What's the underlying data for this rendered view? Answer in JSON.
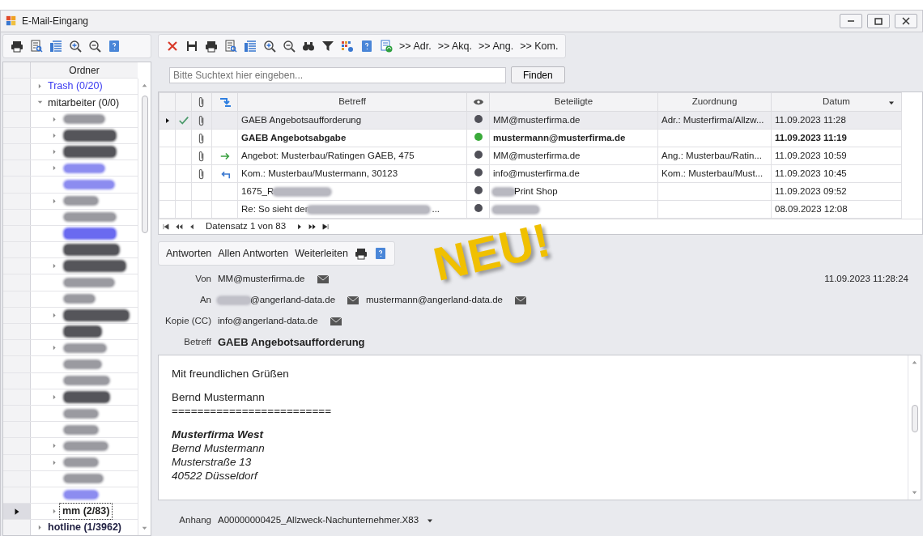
{
  "window": {
    "title": "E-Mail-Eingang"
  },
  "folder_panel": {
    "header": "Ordner",
    "folders": [
      {
        "label": "Trash (0/20)",
        "color": "#3a3af0",
        "bold": false,
        "expanded": false,
        "selected": false
      },
      {
        "label": "mitarbeiter (0/0)",
        "color": "#222222",
        "bold": false,
        "expanded": true,
        "selected": false,
        "children": [
          {
            "redacted": true,
            "expandable": true,
            "bold": false,
            "color": "#9a9aa0",
            "selected": false
          },
          {
            "redacted": true,
            "expandable": true,
            "bold": true,
            "color": "#55555a",
            "selected": false
          },
          {
            "redacted": true,
            "expandable": true,
            "bold": true,
            "color": "#55555a",
            "selected": false
          },
          {
            "redacted": true,
            "expandable": true,
            "bold": false,
            "color": "#8c8cf0",
            "selected": false
          },
          {
            "redacted": true,
            "expandable": false,
            "bold": false,
            "color": "#8c8cf0",
            "selected": false
          },
          {
            "redacted": true,
            "expandable": true,
            "bold": false,
            "color": "#9a9aa0",
            "selected": false
          },
          {
            "redacted": true,
            "expandable": false,
            "bold": false,
            "color": "#9a9aa0",
            "selected": false
          },
          {
            "redacted": true,
            "expandable": false,
            "bold": true,
            "color": "#6a6af0",
            "selected": false
          },
          {
            "redacted": true,
            "expandable": false,
            "bold": true,
            "color": "#55555a",
            "selected": false
          },
          {
            "redacted": true,
            "expandable": true,
            "bold": true,
            "color": "#55555a",
            "selected": false
          },
          {
            "redacted": true,
            "expandable": false,
            "bold": false,
            "color": "#9a9aa0",
            "selected": false
          },
          {
            "redacted": true,
            "expandable": false,
            "bold": false,
            "color": "#9a9aa0",
            "selected": false
          },
          {
            "redacted": true,
            "expandable": true,
            "bold": true,
            "color": "#55555a",
            "selected": false
          },
          {
            "redacted": true,
            "expandable": false,
            "bold": true,
            "color": "#55555a",
            "selected": false
          },
          {
            "redacted": true,
            "expandable": true,
            "bold": false,
            "color": "#9a9aa0",
            "selected": false
          },
          {
            "redacted": true,
            "expandable": false,
            "bold": false,
            "color": "#9a9aa0",
            "selected": false
          },
          {
            "redacted": true,
            "expandable": false,
            "bold": false,
            "color": "#9a9aa0",
            "selected": false
          },
          {
            "redacted": true,
            "expandable": true,
            "bold": true,
            "color": "#55555a",
            "selected": false
          },
          {
            "redacted": true,
            "expandable": false,
            "bold": false,
            "color": "#9a9aa0",
            "selected": false
          },
          {
            "redacted": true,
            "expandable": false,
            "bold": false,
            "color": "#9a9aa0",
            "selected": false
          },
          {
            "redacted": true,
            "expandable": true,
            "bold": false,
            "color": "#9a9aa0",
            "selected": false
          },
          {
            "redacted": true,
            "expandable": true,
            "bold": false,
            "color": "#9a9aa0",
            "selected": false
          },
          {
            "redacted": true,
            "expandable": false,
            "bold": false,
            "color": "#9a9aa0",
            "selected": false
          },
          {
            "redacted": true,
            "expandable": false,
            "bold": false,
            "color": "#8c8cf0",
            "selected": false
          },
          {
            "redacted": false,
            "label": "mm (2/83)",
            "expandable": true,
            "bold": true,
            "color": "#222222",
            "selected": true
          }
        ]
      },
      {
        "label": "hotline (1/3962)",
        "color": "#222244",
        "bold": true,
        "expanded": false,
        "selected": false
      }
    ]
  },
  "toolbar": {
    "text_buttons": [
      ">> Adr.",
      ">> Akq.",
      ">> Ang.",
      ">> Kom."
    ]
  },
  "search": {
    "placeholder": "Bitte Suchtext hier eingeben...",
    "button": "Finden"
  },
  "mail_grid": {
    "columns": [
      "Betreff",
      "Beteiligte",
      "Zuordnung",
      "Datum"
    ],
    "rows": [
      {
        "selected": true,
        "done": true,
        "attachment": true,
        "forwarded": false,
        "replied": false,
        "unread": false,
        "subject": "GAEB Angebotsaufforderung",
        "subject_redacted": false,
        "color": "#505058",
        "participant_redacted": false,
        "participant": "MM@musterfirma.de",
        "assignment": "Adr.: Musterfirma/Allzw...",
        "date": "11.09.2023 11:28"
      },
      {
        "selected": false,
        "done": false,
        "attachment": true,
        "forwarded": false,
        "replied": false,
        "unread": true,
        "subject": "GAEB Angebotsabgabe",
        "subject_redacted": false,
        "color": "#3aaa3a",
        "participant_redacted": false,
        "participant": "mustermann@musterfirma.de",
        "date": "11.09.2023 11:19"
      },
      {
        "selected": false,
        "done": false,
        "attachment": true,
        "forwarded": true,
        "replied": false,
        "unread": false,
        "subject": "Angebot: Musterbau/Ratingen GAEB, 475",
        "subject_redacted": false,
        "color": "#505058",
        "participant_redacted": false,
        "participant": "MM@musterfirma.de",
        "assignment": "Ang.: Musterbau/Ratin...",
        "date": "11.09.2023 10:59"
      },
      {
        "selected": false,
        "done": false,
        "attachment": true,
        "forwarded": false,
        "replied": true,
        "unread": false,
        "subject": "Kom.: Musterbau/Mustermann, 30123",
        "subject_redacted": false,
        "color": "#505058",
        "participant_redacted": false,
        "participant": "info@musterfirma.de",
        "assignment": "Kom.: Musterbau/Must...",
        "date": "11.09.2023 10:45"
      },
      {
        "selected": false,
        "done": false,
        "attachment": false,
        "forwarded": false,
        "replied": false,
        "unread": false,
        "subject": "1675_R",
        "subject_redacted": true,
        "color": "#505058",
        "participant_redacted": true,
        "participant": "Print Shop",
        "date": "11.09.2023 09:52"
      },
      {
        "selected": false,
        "done": false,
        "attachment": false,
        "forwarded": false,
        "replied": false,
        "unread": false,
        "subject": "Re: So sieht der",
        "subject_redacted": true,
        "subject_tail": "...",
        "color": "#505058",
        "participant_redacted": true,
        "date": "08.09.2023 12:08"
      }
    ],
    "navigator": "Datensatz 1 von 83"
  },
  "reply_toolbar": {
    "buttons": [
      "Antworten",
      "Allen Antworten",
      "Weiterleiten"
    ]
  },
  "stamp": "NEU!",
  "message": {
    "date": "11.09.2023 11:28:24",
    "fields": [
      {
        "label": "Von",
        "addresses": [
          {
            "redacted": false,
            "text": "MM@musterfirma.de"
          }
        ]
      },
      {
        "label": "An",
        "addresses": [
          {
            "redacted": true,
            "text": "@angerland-data.de"
          },
          {
            "redacted": false,
            "text": "mustermann@angerland-data.de"
          }
        ]
      },
      {
        "label": "Kopie (CC)",
        "addresses": [
          {
            "redacted": false,
            "text": "info@angerland-data.de"
          }
        ]
      }
    ],
    "subject_label": "Betreff",
    "subject": "GAEB Angebotsaufforderung",
    "body": [
      {
        "lines": [
          {
            "kind": "plain",
            "text": "Mit freundlichen Grüßen"
          }
        ]
      },
      {
        "lines": [
          {
            "kind": "plain",
            "text": "Bernd Mustermann"
          },
          {
            "kind": "plain",
            "text": "========================="
          }
        ]
      },
      {
        "lines": [
          {
            "kind": "bold-italic",
            "text": "Musterfirma West"
          },
          {
            "kind": "italic",
            "text": "Bernd Mustermann"
          },
          {
            "kind": "italic",
            "text": "Musterstraße 13"
          },
          {
            "kind": "italic",
            "text": "40522 Düsseldorf"
          }
        ]
      }
    ],
    "attachment_label": "Anhang",
    "attachment": "A00000000425_Allzweck-Nachunternehmer.X83"
  }
}
